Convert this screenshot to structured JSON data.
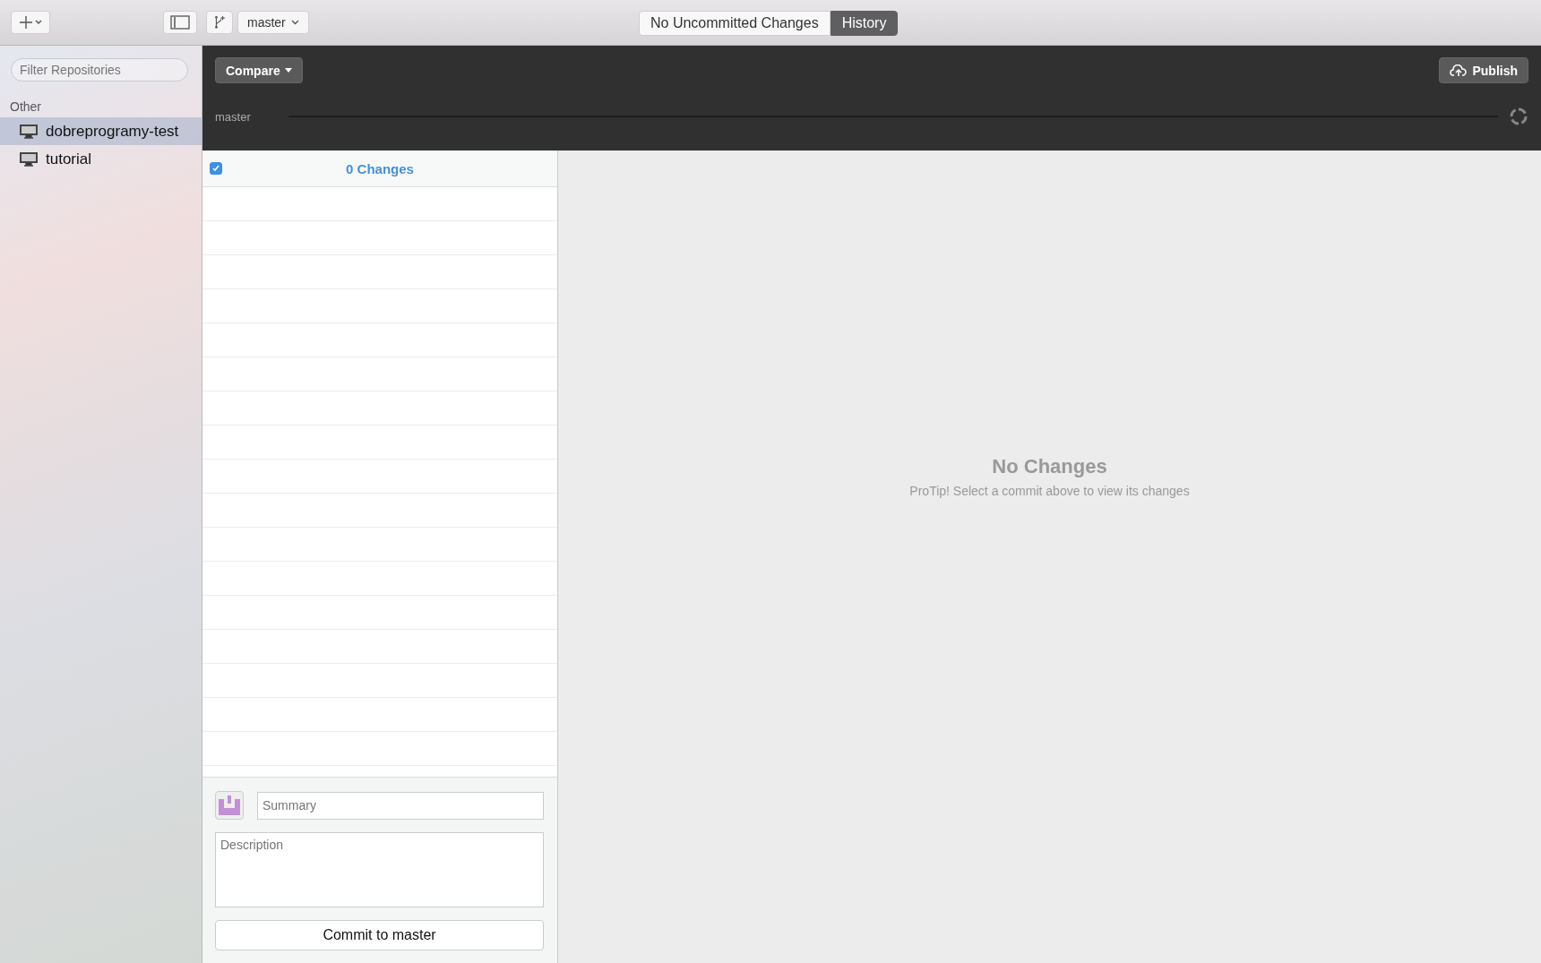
{
  "toolbar": {
    "branch": "master",
    "segments": [
      {
        "label": "No Uncommitted Changes",
        "selected": false
      },
      {
        "label": "History",
        "selected": true
      }
    ]
  },
  "sidebar": {
    "filter_placeholder": "Filter Repositories",
    "group": "Other",
    "repositories": [
      {
        "name": "dobreprogramy-test",
        "selected": true
      },
      {
        "name": "tutorial",
        "selected": false
      }
    ]
  },
  "header": {
    "compare": "Compare",
    "publish": "Publish",
    "timeline_branch": "master"
  },
  "changes": {
    "checked": true,
    "title": "0 Changes"
  },
  "commit": {
    "summary_placeholder": "Summary",
    "description_placeholder": "Description",
    "button": "Commit to master"
  },
  "empty_state": {
    "title": "No Changes",
    "tip": "ProTip! Select a commit above to view its changes"
  }
}
